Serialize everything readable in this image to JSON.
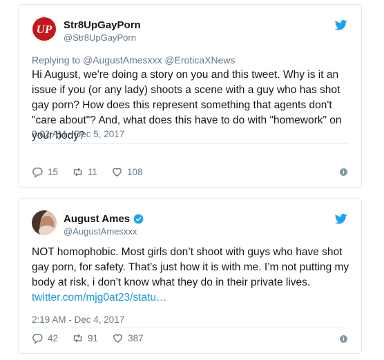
{
  "tweets": [
    {
      "display_name": "Str8UpGayPorn",
      "handle": "@Str8UpGayPorn",
      "avatar_text": "UP",
      "replying_label": "Replying to",
      "replying_mentions": "@AugustAmesxxx @EroticaXNews",
      "text": "Hi August, we're doing a story on you and this tweet. Why is it an issue if you (or any lady) shoots a scene with a guy who has shot gay porn? How does this represent something that agents don't \"care about\"? And, what does this have to do with \"homework\" on your body?",
      "timestamp": "3:02 AM - Dec 5, 2017",
      "replies": "15",
      "retweets": "11",
      "likes": "108"
    },
    {
      "display_name": "August Ames",
      "handle": "@AugustAmesxxx",
      "verified": true,
      "text": "NOT homophobic. Most girls don’t shoot with guys who have shot gay porn, for safety. That’s just how it is with me. I’m not putting my body at risk, i don’t know what they do in their private lives. ",
      "link": "twitter.com/mjg0at23/statu…",
      "timestamp": "2:19 AM - Dec 4, 2017",
      "replies": "42",
      "retweets": "91",
      "likes": "387"
    }
  ],
  "colors": {
    "twitter_blue": "#1da1f2",
    "link_blue": "#1b95e0",
    "gray": "#657786",
    "logo_red": "#c4161c"
  },
  "icons": [
    "reply-icon",
    "retweet-icon",
    "like-icon",
    "info-icon",
    "twitter-bird-icon",
    "verified-badge-icon"
  ]
}
